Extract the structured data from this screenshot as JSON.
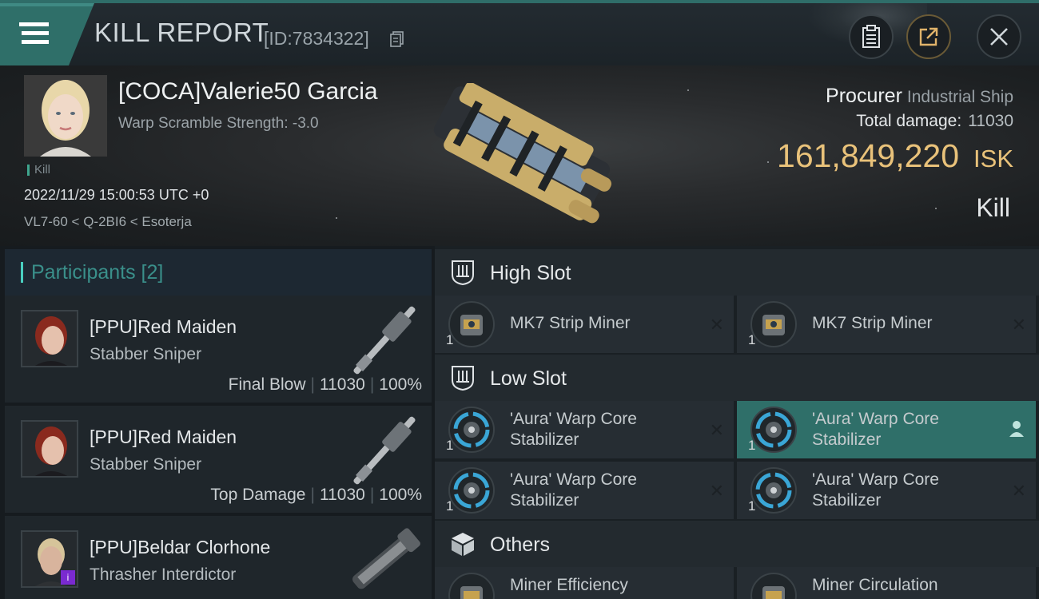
{
  "header": {
    "title": "KILL REPORT",
    "report_id": "[ID:7834322]",
    "icons": [
      "menu-icon",
      "copy-icon",
      "clipboard-icon",
      "share-icon",
      "close-icon"
    ]
  },
  "victim": {
    "name": "[COCA]Valerie50 Garcia",
    "warp_scramble": "Warp Scramble Strength: -3.0",
    "kill_tag": "Kill",
    "datetime": "2022/11/29 15:00:53 UTC +0",
    "location": "VL7-60 < Q-2BI6 < Esoterja",
    "ship_name": "Procurer",
    "ship_class": "Industrial Ship",
    "total_damage_label": "Total damage:",
    "total_damage_value": "11030",
    "isk_value": "161,849,220",
    "isk_unit": "ISK",
    "result": "Kill"
  },
  "participants": {
    "title": "Participants [2]",
    "items": [
      {
        "name": "[PPU]Red Maiden",
        "ship": "Stabber Sniper",
        "role": "Final Blow",
        "damage": "11030",
        "percent": "100%"
      },
      {
        "name": "[PPU]Red Maiden",
        "ship": "Stabber Sniper",
        "role": "Top Damage",
        "damage": "11030",
        "percent": "100%"
      },
      {
        "name": "[PPU]Beldar Clorhone",
        "ship": "Thrasher Interdictor",
        "role": "",
        "damage": "",
        "percent": ""
      }
    ]
  },
  "fitting": {
    "high_slot": {
      "label": "High Slot",
      "modules": [
        {
          "qty": "1",
          "name": "MK7 Strip Miner"
        },
        {
          "qty": "1",
          "name": "MK7 Strip Miner"
        }
      ]
    },
    "low_slot": {
      "label": "Low Slot",
      "modules": [
        {
          "qty": "1",
          "name": "'Aura' Warp Core Stabilizer"
        },
        {
          "qty": "1",
          "name": "'Aura' Warp Core Stabilizer",
          "selected": true
        },
        {
          "qty": "1",
          "name": "'Aura' Warp Core Stabilizer"
        },
        {
          "qty": "1",
          "name": "'Aura' Warp Core Stabilizer"
        }
      ]
    },
    "others": {
      "label": "Others",
      "modules": [
        {
          "qty": "",
          "name": "Miner Efficiency"
        },
        {
          "qty": "",
          "name": "Miner Circulation"
        }
      ]
    }
  },
  "colors": {
    "accent_teal": "#2f6f69",
    "isk_gold": "#e9c27a",
    "purple_badge": "#7a2ad0"
  }
}
